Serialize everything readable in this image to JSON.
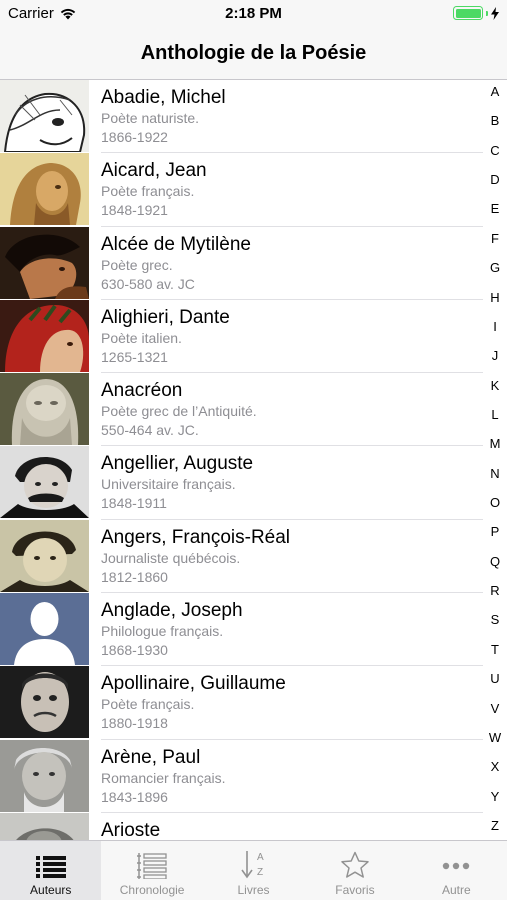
{
  "status_bar": {
    "carrier": "Carrier",
    "time": "2:18 PM",
    "battery_level": 1.0
  },
  "nav": {
    "title": "Anthologie de la Poésie"
  },
  "authors": [
    {
      "name": "Abadie, Michel",
      "description": "Poète naturiste.",
      "dates": "1866-1922"
    },
    {
      "name": "Aicard, Jean",
      "description": "Poète français.",
      "dates": "1848-1921"
    },
    {
      "name": "Alcée de Mytilène",
      "description": "Poète grec.",
      "dates": "630-580 av.  JC"
    },
    {
      "name": "Alighieri, Dante",
      "description": "Poète italien.",
      "dates": "1265-1321"
    },
    {
      "name": "Anacréon",
      "description": "Poète grec de l’Antiquité.",
      "dates": "550-464 av. JC."
    },
    {
      "name": "Angellier, Auguste",
      "description": "Universitaire français.",
      "dates": "1848-1911"
    },
    {
      "name": "Angers, François-Réal",
      "description": "Journaliste québécois.",
      "dates": "1812-1860"
    },
    {
      "name": "Anglade, Joseph",
      "description": "Philologue français.",
      "dates": "1868-1930"
    },
    {
      "name": "Apollinaire, Guillaume",
      "description": "Poète français.",
      "dates": "1880-1918"
    },
    {
      "name": "Arène, Paul",
      "description": "Romancier français.",
      "dates": "1843-1896"
    },
    {
      "name": "Arioste",
      "description": "",
      "dates": ""
    }
  ],
  "index_letters": [
    "A",
    "B",
    "C",
    "D",
    "E",
    "F",
    "G",
    "H",
    "I",
    "J",
    "K",
    "L",
    "M",
    "N",
    "O",
    "P",
    "Q",
    "R",
    "S",
    "T",
    "U",
    "V",
    "W",
    "X",
    "Y",
    "Z"
  ],
  "tabs": [
    {
      "label": "Auteurs",
      "icon": "list-icon",
      "active": true
    },
    {
      "label": "Chronologie",
      "icon": "timeline-icon",
      "active": false
    },
    {
      "label": "Livres",
      "icon": "sort-az-icon",
      "active": false
    },
    {
      "label": "Favoris",
      "icon": "star-icon",
      "active": false
    },
    {
      "label": "Autre",
      "icon": "more-icon",
      "active": false
    }
  ],
  "colors": {
    "accent_active": "#111111",
    "inactive": "#929292",
    "battery": "#4cd964",
    "secondary_text": "#8e8e93"
  }
}
